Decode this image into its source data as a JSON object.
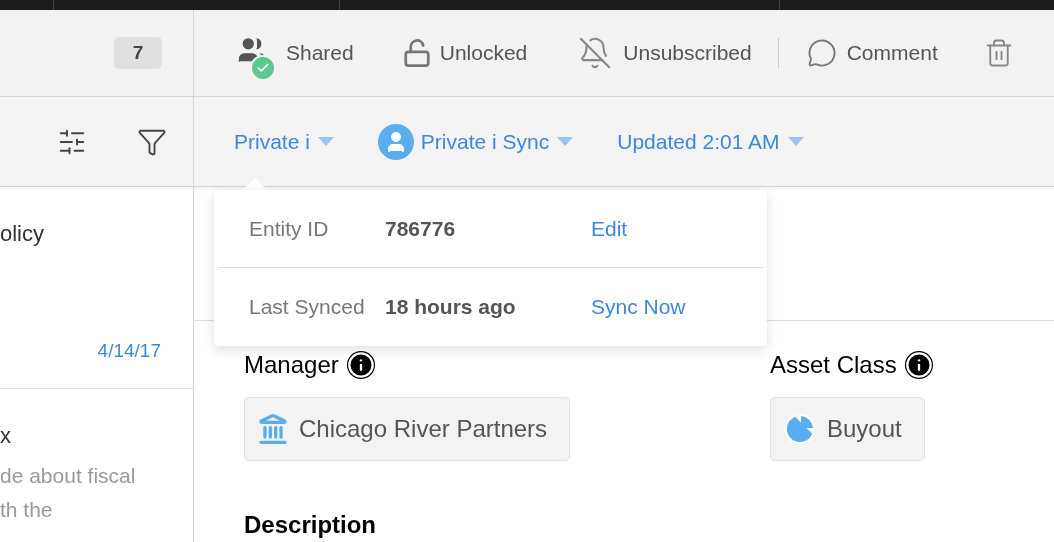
{
  "sidebar": {
    "count": "7",
    "items": [
      {
        "title": "olicy",
        "date": "4/14/17"
      },
      {
        "title": "x",
        "snippet": [
          "de about fiscal",
          "th the"
        ]
      }
    ]
  },
  "toolbar": [
    {
      "kind": "shared",
      "label": "Shared"
    },
    {
      "kind": "unlocked",
      "label": "Unlocked"
    },
    {
      "kind": "unsubscribed",
      "label": "Unsubscribed"
    },
    {
      "kind": "comment",
      "label": "Comment"
    },
    {
      "kind": "trash"
    }
  ],
  "filters": [
    {
      "kind": "text",
      "label": "Private i"
    },
    {
      "kind": "avatar",
      "label": "Private i Sync"
    },
    {
      "kind": "text",
      "label": "Updated 2:01 AM"
    }
  ],
  "popover": {
    "rows": [
      {
        "label": "Entity ID",
        "value": "786776",
        "action": "Edit"
      },
      {
        "label": "Last Synced",
        "value": "18 hours ago",
        "action": "Sync Now"
      }
    ]
  },
  "fields": [
    {
      "label": "Manager",
      "value": "Chicago River Partners",
      "kind": "institution"
    },
    {
      "label": "Asset Class",
      "value": "Buyout",
      "kind": "pie"
    }
  ],
  "description_heading": "Description"
}
